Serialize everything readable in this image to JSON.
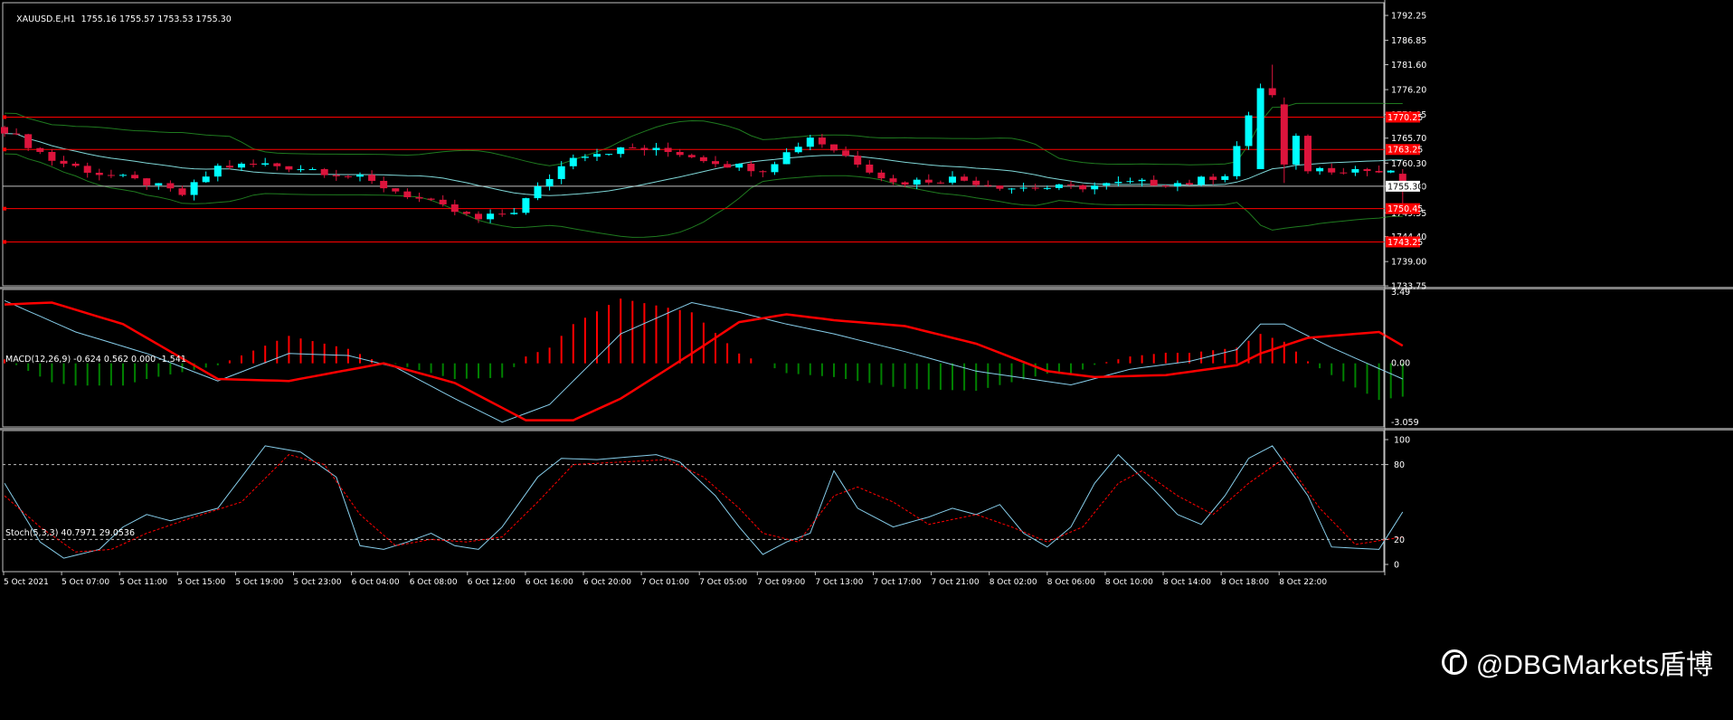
{
  "colors": {
    "background": "#000000",
    "bull_candle": "#00ffff",
    "bear_candle": "#dc143c",
    "bollinger": "#1f7a1f",
    "mid_band": "#7fd7d7",
    "level_lines": "#ff0000",
    "bid_line": "#c0c0c0",
    "macd_main": "#87ceeb",
    "macd_signal": "#ff0000",
    "hist_pos": "#ff0000",
    "hist_neg": "#008000",
    "stoch_main": "#87ceeb",
    "stoch_signal": "#ff0000"
  },
  "header": {
    "symbol": "XAUUSD.E,H1",
    "ohlc": "1755.16 1755.57 1753.53 1755.30"
  },
  "macd": {
    "label": "MACD(12,26,9) -0.624 0.562 0.000 -1.541",
    "ticks": [
      "3.49",
      "0.00",
      "-3.059"
    ]
  },
  "stoch": {
    "label": "Stoch(5,3,3) 40.7971 29.0536",
    "ticks": [
      "100",
      "80",
      "20",
      "0"
    ]
  },
  "price_axis": {
    "ticks": [
      "1792.25",
      "1786.85",
      "1781.60",
      "1776.20",
      "1770.85",
      "1765.70",
      "1760.30",
      "1755.30",
      "1749.55",
      "1744.40",
      "1739.00",
      "1733.75"
    ],
    "current": "1755.30",
    "levels": [
      {
        "price": 1770.25,
        "label": "1770.25"
      },
      {
        "price": 1763.25,
        "label": "1763.25"
      },
      {
        "price": 1750.45,
        "label": "1750.45"
      },
      {
        "price": 1743.25,
        "label": "1743.25"
      }
    ]
  },
  "time_axis": [
    "5 Oct 2021",
    "5 Oct 07:00",
    "5 Oct 11:00",
    "5 Oct 15:00",
    "5 Oct 19:00",
    "5 Oct 23:00",
    "6 Oct 04:00",
    "6 Oct 08:00",
    "6 Oct 12:00",
    "6 Oct 16:00",
    "6 Oct 20:00",
    "7 Oct 01:00",
    "7 Oct 05:00",
    "7 Oct 09:00",
    "7 Oct 13:00",
    "7 Oct 17:00",
    "7 Oct 21:00",
    "8 Oct 02:00",
    "8 Oct 06:00",
    "8 Oct 10:00",
    "8 Oct 14:00",
    "8 Oct 18:00",
    "8 Oct 22:00"
  ],
  "watermark": "@DBGMarkets盾博",
  "chart_data": [
    {
      "type": "candlestick",
      "title": "XAUUSD.E,H1",
      "ylim": [
        1733.75,
        1795.0
      ],
      "close_anchors": [
        [
          0,
          1767.5
        ],
        [
          4,
          1761
        ],
        [
          8,
          1758
        ],
        [
          12,
          1756
        ],
        [
          15,
          1753.5
        ],
        [
          18,
          1759.5
        ],
        [
          22,
          1760
        ],
        [
          26,
          1759
        ],
        [
          30,
          1757
        ],
        [
          35,
          1752.5
        ],
        [
          40,
          1748
        ],
        [
          43,
          1750
        ],
        [
          48,
          1762
        ],
        [
          53,
          1763.5
        ],
        [
          57,
          1762.5
        ],
        [
          61,
          1760
        ],
        [
          64,
          1759
        ],
        [
          68,
          1766
        ],
        [
          72,
          1760.5
        ],
        [
          75,
          1756
        ],
        [
          80,
          1757
        ],
        [
          85,
          1755
        ],
        [
          90,
          1755
        ],
        [
          95,
          1756
        ],
        [
          100,
          1756
        ],
        [
          103,
          1758
        ],
        [
          106,
          1776
        ],
        [
          107,
          1777
        ],
        [
          108,
          1772
        ],
        [
          110,
          1759
        ],
        [
          114,
          1759
        ],
        [
          117,
          1758
        ],
        [
          118,
          1755.3
        ]
      ],
      "special_candles": [
        {
          "i": 106,
          "o": 1759,
          "h": 1777.5,
          "l": 1759,
          "c": 1776.5
        },
        {
          "i": 107,
          "o": 1776.5,
          "h": 1781.6,
          "l": 1774.5,
          "c": 1775
        },
        {
          "i": 108,
          "o": 1773,
          "h": 1774.5,
          "l": 1756,
          "c": 1760
        },
        {
          "i": 118,
          "o": 1758,
          "h": 1759,
          "l": 1751,
          "c": 1755.3
        }
      ]
    },
    {
      "type": "bar",
      "title": "MACD(12,26,9)",
      "ylim": [
        -3.059,
        3.49
      ],
      "main_anchors": [
        [
          0,
          3.2
        ],
        [
          6,
          1.6
        ],
        [
          12,
          0.5
        ],
        [
          18,
          -0.9
        ],
        [
          24,
          0.5
        ],
        [
          29,
          0.4
        ],
        [
          33,
          -0.2
        ],
        [
          38,
          -1.8
        ],
        [
          42,
          -3.0
        ],
        [
          46,
          -2.1
        ],
        [
          52,
          1.5
        ],
        [
          58,
          3.1
        ],
        [
          62,
          2.6
        ],
        [
          66,
          2.0
        ],
        [
          70,
          1.5
        ],
        [
          76,
          0.6
        ],
        [
          82,
          -0.4
        ],
        [
          90,
          -1.1
        ],
        [
          95,
          -0.3
        ],
        [
          100,
          0.1
        ],
        [
          104,
          0.7
        ],
        [
          106,
          2.0
        ],
        [
          108,
          2.0
        ],
        [
          112,
          0.8
        ],
        [
          118,
          -0.8
        ]
      ],
      "signal_anchors": [
        [
          0,
          3.0
        ],
        [
          4,
          3.1
        ],
        [
          10,
          2.0
        ],
        [
          18,
          -0.8
        ],
        [
          24,
          -0.9
        ],
        [
          32,
          0.0
        ],
        [
          38,
          -1.0
        ],
        [
          44,
          -2.9
        ],
        [
          48,
          -2.9
        ],
        [
          52,
          -1.8
        ],
        [
          58,
          0.5
        ],
        [
          62,
          2.1
        ],
        [
          66,
          2.5
        ],
        [
          70,
          2.2
        ],
        [
          76,
          1.9
        ],
        [
          82,
          1.0
        ],
        [
          88,
          -0.4
        ],
        [
          92,
          -0.7
        ],
        [
          98,
          -0.6
        ],
        [
          104,
          -0.1
        ],
        [
          106,
          0.5
        ],
        [
          110,
          1.3
        ],
        [
          116,
          1.6
        ],
        [
          118,
          0.9
        ]
      ]
    },
    {
      "type": "line",
      "title": "Stoch(5,3,3)",
      "ylim": [
        0,
        100
      ],
      "levels": [
        80,
        20
      ],
      "main_anchors": [
        [
          0,
          65
        ],
        [
          3,
          18
        ],
        [
          5,
          5
        ],
        [
          8,
          12
        ],
        [
          10,
          30
        ],
        [
          12,
          40
        ],
        [
          14,
          35
        ],
        [
          18,
          45
        ],
        [
          22,
          95
        ],
        [
          25,
          90
        ],
        [
          28,
          70
        ],
        [
          30,
          15
        ],
        [
          32,
          12
        ],
        [
          34,
          18
        ],
        [
          36,
          25
        ],
        [
          38,
          15
        ],
        [
          40,
          12
        ],
        [
          42,
          30
        ],
        [
          45,
          70
        ],
        [
          47,
          85
        ],
        [
          50,
          84
        ],
        [
          55,
          88
        ],
        [
          57,
          82
        ],
        [
          60,
          55
        ],
        [
          62,
          30
        ],
        [
          64,
          8
        ],
        [
          66,
          18
        ],
        [
          68,
          25
        ],
        [
          70,
          75
        ],
        [
          72,
          45
        ],
        [
          75,
          30
        ],
        [
          78,
          38
        ],
        [
          80,
          45
        ],
        [
          82,
          40
        ],
        [
          84,
          48
        ],
        [
          86,
          25
        ],
        [
          88,
          14
        ],
        [
          90,
          30
        ],
        [
          92,
          65
        ],
        [
          94,
          88
        ],
        [
          97,
          60
        ],
        [
          99,
          40
        ],
        [
          101,
          32
        ],
        [
          103,
          55
        ],
        [
          105,
          85
        ],
        [
          107,
          95
        ],
        [
          110,
          55
        ],
        [
          112,
          14
        ],
        [
          116,
          12
        ],
        [
          118,
          42
        ],
        [
          120,
          50
        ]
      ],
      "signal_anchors": [
        [
          0,
          55
        ],
        [
          3,
          30
        ],
        [
          6,
          10
        ],
        [
          9,
          12
        ],
        [
          12,
          25
        ],
        [
          16,
          38
        ],
        [
          20,
          50
        ],
        [
          24,
          88
        ],
        [
          27,
          80
        ],
        [
          30,
          40
        ],
        [
          33,
          15
        ],
        [
          36,
          20
        ],
        [
          39,
          18
        ],
        [
          42,
          22
        ],
        [
          45,
          50
        ],
        [
          48,
          80
        ],
        [
          52,
          82
        ],
        [
          56,
          84
        ],
        [
          59,
          70
        ],
        [
          62,
          45
        ],
        [
          64,
          25
        ],
        [
          67,
          18
        ],
        [
          70,
          55
        ],
        [
          72,
          62
        ],
        [
          75,
          50
        ],
        [
          78,
          32
        ],
        [
          82,
          40
        ],
        [
          85,
          30
        ],
        [
          88,
          18
        ],
        [
          91,
          30
        ],
        [
          94,
          65
        ],
        [
          96,
          75
        ],
        [
          99,
          55
        ],
        [
          102,
          40
        ],
        [
          105,
          65
        ],
        [
          108,
          85
        ],
        [
          111,
          45
        ],
        [
          114,
          16
        ],
        [
          118,
          22
        ],
        [
          120,
          30
        ]
      ]
    }
  ]
}
